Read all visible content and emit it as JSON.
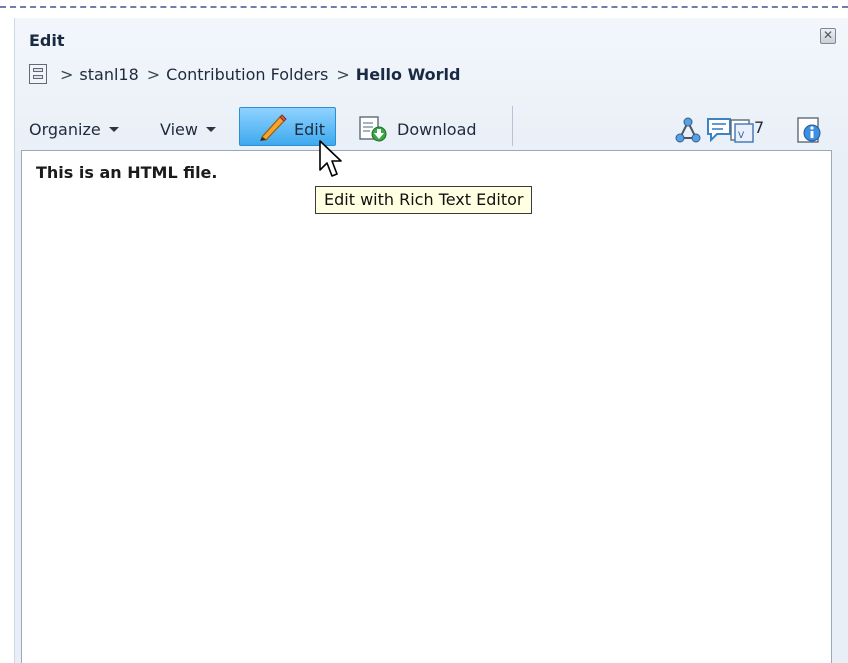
{
  "window": {
    "title": "Edit",
    "close_glyph": "✕"
  },
  "breadcrumb": {
    "items": [
      "stanl18",
      "Contribution Folders"
    ],
    "current": "Hello World",
    "separator": ">"
  },
  "toolbar": {
    "organize_label": "Organize",
    "view_label": "View",
    "edit_label": "Edit",
    "download_label": "Download",
    "count_value": "7"
  },
  "icons": {
    "breadcrumb_root": "library-icon",
    "pencil": "pencil-icon",
    "download": "download-icon",
    "links": "links-icon",
    "comments": "comments-icon",
    "versions": "versions-icon",
    "info": "info-icon"
  },
  "content": {
    "text": "This is an HTML file."
  },
  "tooltip": {
    "text": "Edit with Rich Text Editor"
  },
  "colors": {
    "edit_button": "#3ea9ee",
    "tooltip_bg": "#ffffe1",
    "panel_bg": "#eef3f9"
  }
}
